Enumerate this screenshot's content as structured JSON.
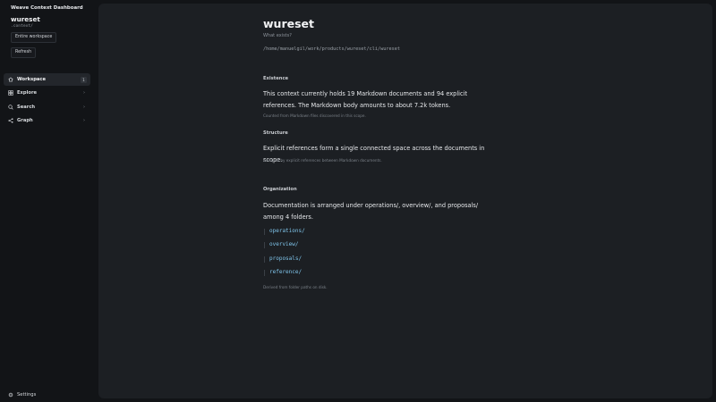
{
  "sidebar": {
    "app_title": "Weave Context Dashboard",
    "context_name": "wureset",
    "context_path": ".context/",
    "buttons": {
      "entire_workspace": "Entire workspace",
      "refresh": "Refresh"
    },
    "nav": [
      {
        "label": "Workspace",
        "icon": "home-icon",
        "badge": "1",
        "active": true
      },
      {
        "label": "Explore",
        "icon": "grid-icon",
        "active": false
      },
      {
        "label": "Search",
        "icon": "search-icon",
        "active": false
      },
      {
        "label": "Graph",
        "icon": "share-icon",
        "active": false
      }
    ],
    "settings_label": "Settings"
  },
  "main": {
    "title": "wureset",
    "subtitle": "What exists?",
    "path": "/home/manuelgil/work/products/wureset/cli/wureset",
    "sections": {
      "existence": {
        "heading": "Existence",
        "text": "This context currently holds 19 Markdown documents and 94 explicit references. The Markdown body amounts to about 7.2k tokens.",
        "note": "Counted from Markdown files discovered in this scope."
      },
      "structure": {
        "heading": "Structure",
        "text": "Explicit references form a single connected space across the documents in scope.",
        "note": "Grouped by explicit references between Markdown documents."
      },
      "organization": {
        "heading": "Organization",
        "text": "Documentation is arranged under operations/, overview/, and proposals/ among 4 folders.",
        "folders": [
          "operations/",
          "overview/",
          "proposals/",
          "reference/"
        ],
        "note": "Derived from folder paths on disk."
      }
    }
  },
  "colors": {
    "background": "#121417",
    "panel": "#1c1f23",
    "accent": "#7fc4ea"
  }
}
